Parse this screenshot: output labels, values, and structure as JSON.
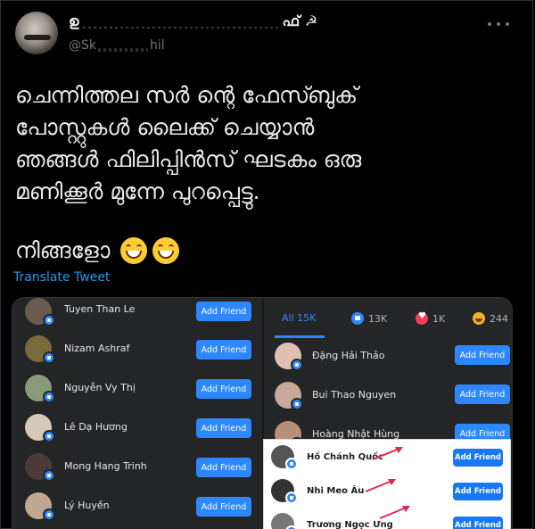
{
  "tweet": {
    "author_name_start": "ഉ",
    "author_name_end": "ഫ് ☭",
    "handle_start": "@Sk",
    "handle_end": "hil",
    "more_label": "More",
    "lines": [
      "ചെന്നിത്തല സർ ന്റെ ഫേസ്ബുക്",
      "പോസ്റ്റുകൾ ലൈക്ക് ചെയ്യാൻ",
      "ഞങ്ങൾ ഫിലിപ്പിൻസ് ഘടകം ഒരു",
      "മണിക്കൂർ മുന്നേ പുറപ്പെട്ടു."
    ],
    "last_line": "നിങ്ങളോ",
    "emojis": [
      "grinning-face-emoji",
      "grinning-face-emoji"
    ],
    "translate_label": "Translate Tweet"
  },
  "left_list": {
    "add_label": "Add Friend",
    "people": [
      {
        "name": "Tuyen Than Le",
        "avatar": "#6b5a50"
      },
      {
        "name": "Nizam Ashraf",
        "avatar": "#7a6a3a"
      },
      {
        "name": "Nguyễn Vy Thị",
        "avatar": "#8a9a7a"
      },
      {
        "name": "Lê Dạ Hương",
        "avatar": "#d8c8b8"
      },
      {
        "name": "Mong Hang Trinh",
        "avatar": "#4a3a3a"
      },
      {
        "name": "Lý Huyền",
        "avatar": "#c0a890"
      }
    ]
  },
  "right_list": {
    "tabs": {
      "all": "All 15K",
      "like": "13K",
      "love": "1K",
      "haha": "244"
    },
    "add_label": "Add Friend",
    "people": [
      {
        "name": "Đặng Hải Thảo",
        "avatar": "#e0c0b0"
      },
      {
        "name": "Bui Thao Nguyen",
        "avatar": "#c8a898"
      },
      {
        "name": "Hoàng Nhật Hùng",
        "avatar": "#b89078"
      }
    ]
  },
  "overlay_list": {
    "add_label": "Add Friend",
    "people": [
      {
        "name": "Hồ Chánh Quốc",
        "avatar": "#555"
      },
      {
        "name": "Nhi Meo Âu",
        "avatar": "#333"
      },
      {
        "name": "Trương Ngọc Ưng",
        "avatar": "#777"
      }
    ]
  },
  "colors": {
    "accent": "#1d9bf0",
    "fb_blue": "#2d88ff",
    "arrow_red": "#e0284f"
  }
}
